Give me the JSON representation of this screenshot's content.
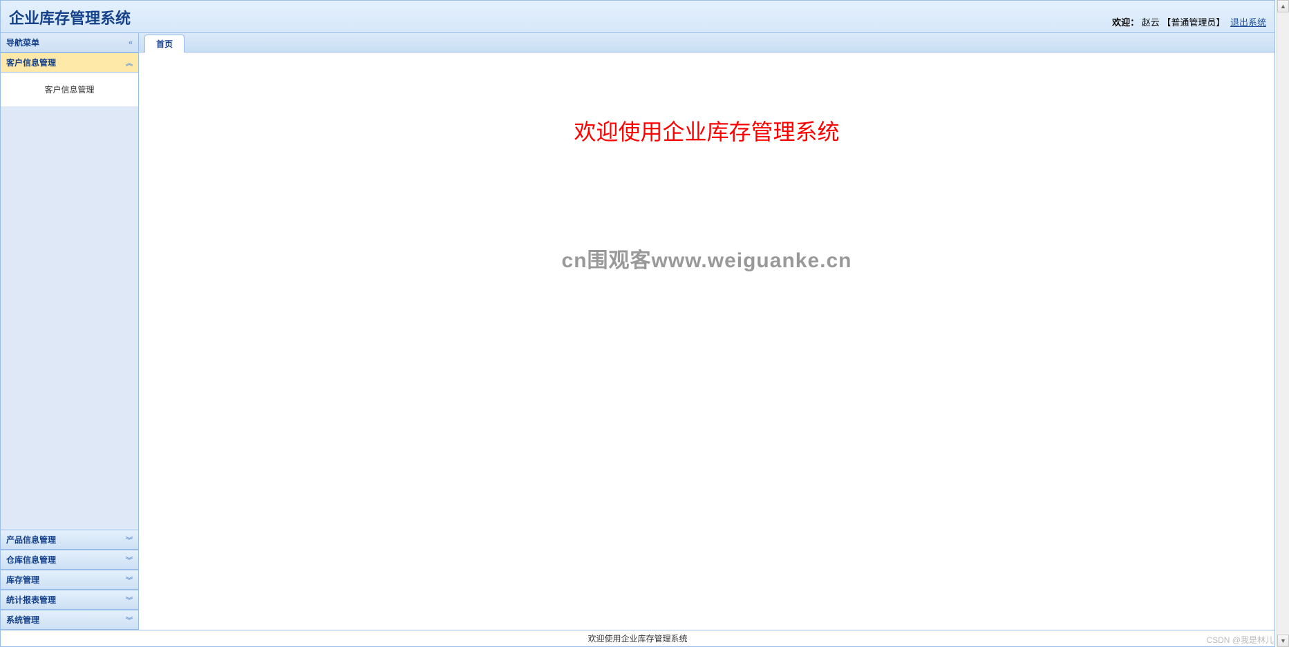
{
  "header": {
    "app_title": "企业库存管理系统",
    "welcome_label": "欢迎：",
    "user_name": "赵云",
    "user_role": "【普通管理员】",
    "logout_label": "退出系统"
  },
  "sidebar": {
    "title": "导航菜单",
    "collapse_glyph": "«",
    "expand_glyph": "»",
    "up_glyph": "︽",
    "down_glyph": "︾",
    "sections": [
      {
        "label": "客户信息管理",
        "expanded": true,
        "items": [
          {
            "label": "客户信息管理"
          }
        ]
      },
      {
        "label": "产品信息管理",
        "expanded": false
      },
      {
        "label": "仓库信息管理",
        "expanded": false
      },
      {
        "label": "库存管理",
        "expanded": false
      },
      {
        "label": "统计报表管理",
        "expanded": false
      },
      {
        "label": "系统管理",
        "expanded": false
      }
    ]
  },
  "tabs": [
    {
      "label": "首页"
    }
  ],
  "main": {
    "welcome_heading": "欢迎使用企业库存管理系统",
    "watermark": "cn围观客www.weiguanke.cn"
  },
  "footer": {
    "text": "欢迎使用企业库存管理系统"
  },
  "credit": "CSDN @我是林儿"
}
